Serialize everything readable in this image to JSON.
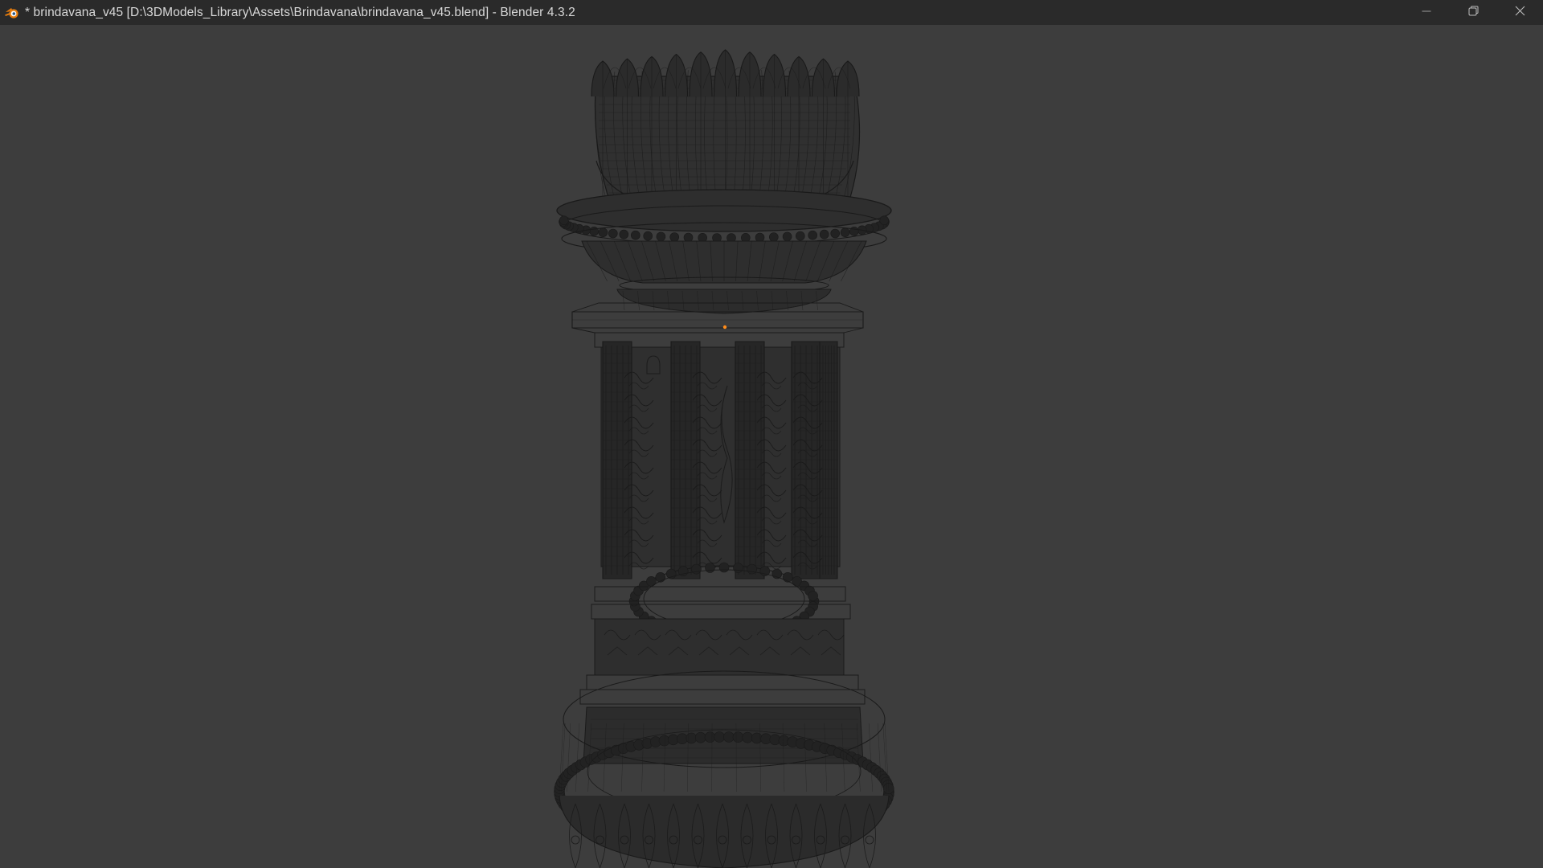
{
  "window": {
    "title": "* brindavana_v45 [D:\\3DModels_Library\\Assets\\Brindavana\\brindavana_v45.blend] - Blender 4.3.2",
    "app_icon": "blender-logo-icon",
    "controls": {
      "minimize_icon": "minimize-icon",
      "restore_icon": "restore-icon",
      "close_icon": "close-icon"
    }
  },
  "viewport": {
    "mode": "wireframe",
    "object": "brindavana",
    "background_color": "#3d3d3d",
    "wire_color": "#1a1a1a",
    "origin_color": "#ff8c1a"
  }
}
